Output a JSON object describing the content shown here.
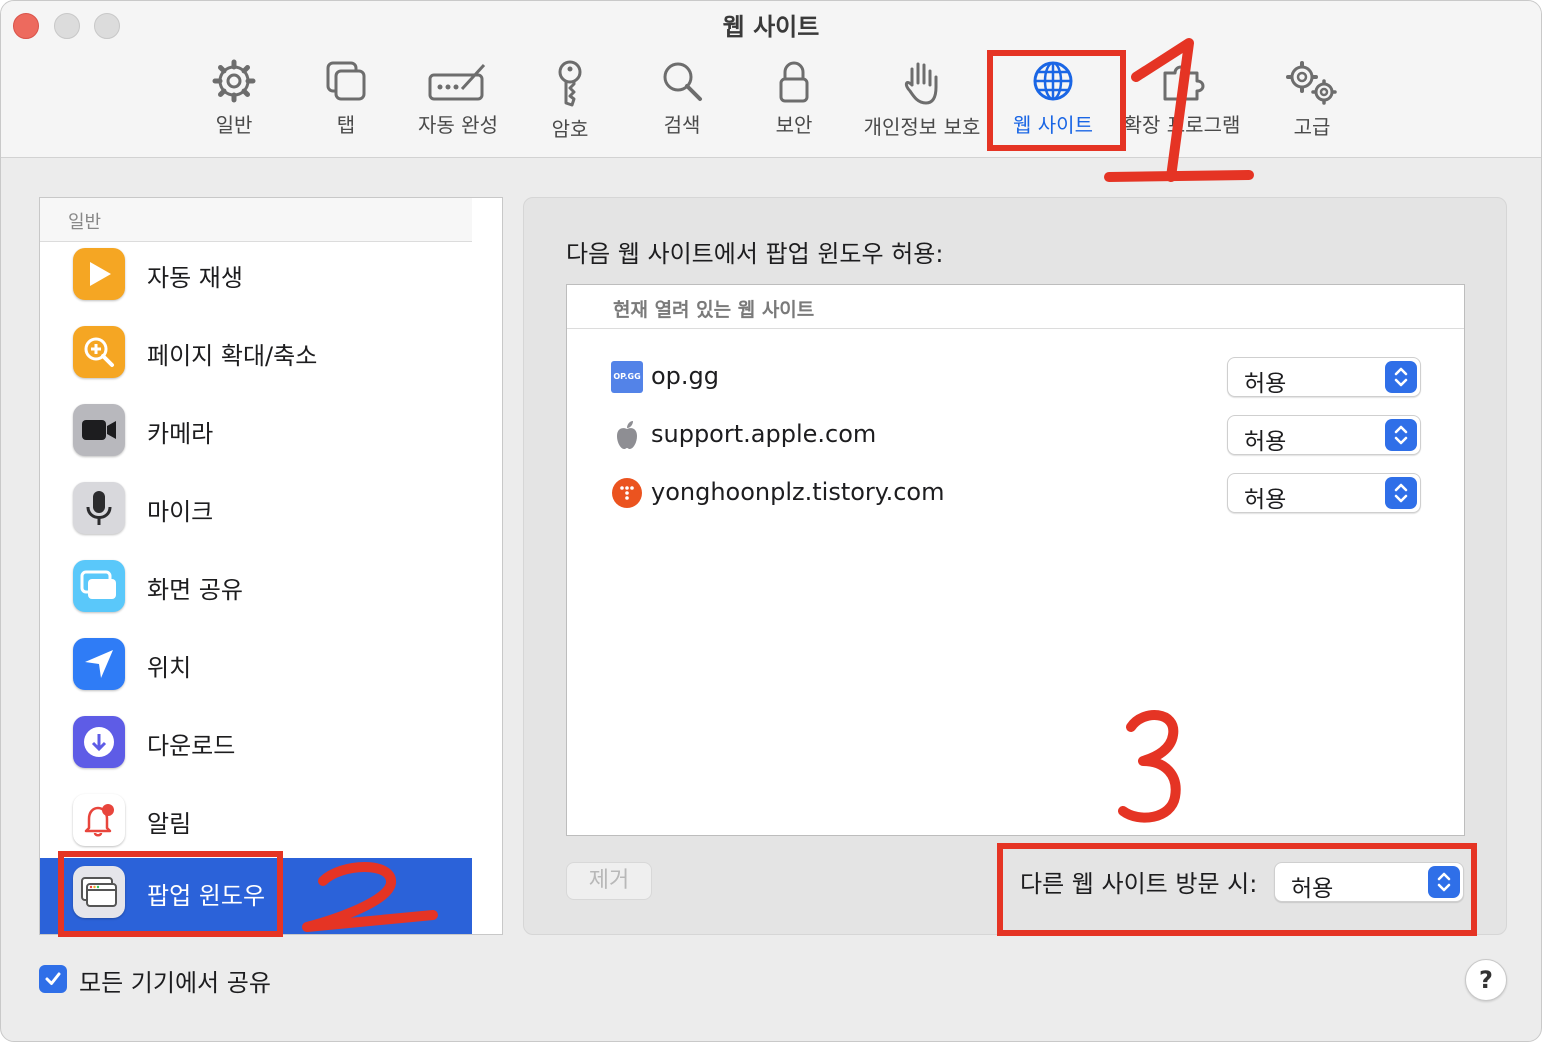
{
  "window": {
    "title": "웹 사이트"
  },
  "toolbar": {
    "items": [
      {
        "label": "일반",
        "icon": "gear-icon"
      },
      {
        "label": "탭",
        "icon": "tabs-icon"
      },
      {
        "label": "자동 완성",
        "icon": "autofill-icon"
      },
      {
        "label": "암호",
        "icon": "key-icon"
      },
      {
        "label": "검색",
        "icon": "search-icon"
      },
      {
        "label": "보안",
        "icon": "lock-icon"
      },
      {
        "label": "개인정보 보호",
        "icon": "hand-icon"
      },
      {
        "label": "웹 사이트",
        "icon": "globe-icon",
        "active": true
      },
      {
        "label": "확장 프로그램",
        "icon": "puzzle-icon"
      },
      {
        "label": "고급",
        "icon": "advanced-gears-icon"
      }
    ]
  },
  "sidebar": {
    "section_header": "일반",
    "items": [
      {
        "label": "자동 재생",
        "icon": "play-icon",
        "color": "#f5a623"
      },
      {
        "label": "페이지 확대/축소",
        "icon": "zoom-icon",
        "color": "#f5a623"
      },
      {
        "label": "카메라",
        "icon": "camera-icon",
        "color": "#8e8e93"
      },
      {
        "label": "마이크",
        "icon": "microphone-icon",
        "color": "#d1d1d6"
      },
      {
        "label": "화면 공유",
        "icon": "screen-share-icon",
        "color": "#5ac8fa"
      },
      {
        "label": "위치",
        "icon": "location-icon",
        "color": "#2f7cf6"
      },
      {
        "label": "다운로드",
        "icon": "download-icon",
        "color": "#5e5ce6"
      },
      {
        "label": "알림",
        "icon": "bell-icon",
        "color": "#ffffff"
      },
      {
        "label": "팝업 윈도우",
        "icon": "popup-window-icon",
        "color": "#e5e5ea",
        "selected": true
      }
    ]
  },
  "panel": {
    "title": "다음 웹 사이트에서 팝업 윈도우 허용:",
    "table_header": "현재 열려 있는 웹 사이트",
    "sites": [
      {
        "domain": "op.gg",
        "setting": "허용",
        "favicon": "opgg-icon",
        "favicon_text": "OP.GG"
      },
      {
        "domain": "support.apple.com",
        "setting": "허용",
        "favicon": "apple-icon"
      },
      {
        "domain": "yonghoonplz.tistory.com",
        "setting": "허용",
        "favicon": "tistory-icon"
      }
    ],
    "remove_label": "제거",
    "other_label": "다른 웹 사이트 방문 시:",
    "other_value": "허용"
  },
  "footer": {
    "share_label": "모든 기기에서 공유",
    "share_checked": true,
    "help_label": "?"
  },
  "annotations": {
    "color": "#e53424",
    "numbers": [
      "1",
      "2",
      "3"
    ]
  }
}
